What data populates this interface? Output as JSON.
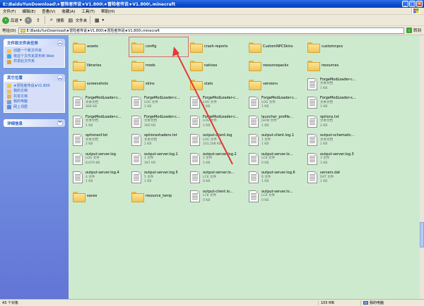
{
  "window": {
    "title": "E:\\BaiduYunDownload\\★冒险者传说★V1.800\\★冒险者传说★V1.800\\.minecraft",
    "btn_min": "_",
    "btn_max": "□",
    "btn_close": "×"
  },
  "menu": [
    "文件(F)",
    "编辑(E)",
    "查看(V)",
    "收藏(A)",
    "工具(T)",
    "帮助(H)"
  ],
  "toolbar": {
    "back_label": "后退",
    "search_label": "搜索",
    "folders_label": "文件夹"
  },
  "address": {
    "label": "地址(D)",
    "path": "E:\\BaiduYunDownload\\★冒险者传说★V1.800\\★冒险者传说★V1.800\\.minecraft",
    "go_label": "转到"
  },
  "sidebar": {
    "tasks_title": "文件和文件夹任务",
    "tasks": [
      "创建一个新文件夹",
      "将这个文件夹发布到 Web",
      "共享此文件夹"
    ],
    "places_title": "其它位置",
    "places": [
      "★冒险者传说★V1.800",
      "我的文档",
      "共享文档",
      "我的电脑",
      "网上邻居"
    ],
    "details_title": "详细信息"
  },
  "items": [
    {
      "name": "assets",
      "type": "folder"
    },
    {
      "name": "config",
      "type": "folder"
    },
    {
      "name": "crash-reports",
      "type": "folder"
    },
    {
      "name": "CustomNPCSkins",
      "type": "folder"
    },
    {
      "name": "customnpcs",
      "type": "folder"
    },
    {
      "name": "libraries",
      "type": "folder"
    },
    {
      "name": "mods",
      "type": "folder"
    },
    {
      "name": "natives",
      "type": "folder"
    },
    {
      "name": "resourcepacks",
      "type": "folder"
    },
    {
      "name": "resources",
      "type": "folder"
    },
    {
      "name": "screenshots",
      "type": "folder"
    },
    {
      "name": "skins",
      "type": "folder"
    },
    {
      "name": "stats",
      "type": "folder"
    },
    {
      "name": "versions",
      "type": "folder"
    },
    {
      "name": "ForgeModLoader-c...",
      "type": "file",
      "kind": "文本文档",
      "size": "1 KB"
    },
    {
      "name": "ForgeModLoader-c...",
      "type": "file",
      "kind": "文本文档",
      "size": "368 KB"
    },
    {
      "name": "ForgeModLoader-c...",
      "type": "file",
      "kind": "LOG 文件",
      "size": "1 KB"
    },
    {
      "name": "ForgeModLoader-c...",
      "type": "file",
      "kind": "LOG 文件",
      "size": "1 KB"
    },
    {
      "name": "ForgeModLoader-c...",
      "type": "file",
      "kind": "LOG 文件",
      "size": "1 KB"
    },
    {
      "name": "ForgeModLoader-s...",
      "type": "file",
      "kind": "文本文档",
      "size": "1 KB"
    },
    {
      "name": "ForgeModLoader-c...",
      "type": "file",
      "kind": "文本文档",
      "size": "1 KB"
    },
    {
      "name": "ForgeModLoader-c...",
      "type": "file",
      "kind": "文本文档",
      "size": "360 KB"
    },
    {
      "name": "ForgeModLoader-c...",
      "type": "file",
      "kind": "LOG 文件",
      "size": "1 KB"
    },
    {
      "name": "launcher_profile...",
      "type": "file",
      "kind": "JSON 文件",
      "size": "1 KB"
    },
    {
      "name": "options.txt",
      "type": "file",
      "kind": "文本文档",
      "size": "2 KB"
    },
    {
      "name": "optionsof.txt",
      "type": "file",
      "kind": "文本文档",
      "size": "2 KB"
    },
    {
      "name": "optionsshaders.txt",
      "type": "file",
      "kind": "文本文档",
      "size": "1 KB"
    },
    {
      "name": "output-client.log",
      "type": "file",
      "kind": "LOG 文件",
      "size": "101,508 KB"
    },
    {
      "name": "output-client.log.1",
      "type": "file",
      "kind": "1 文件",
      "size": "1 KB"
    },
    {
      "name": "output-schematic...",
      "type": "file",
      "kind": "文本文档",
      "size": "1 KB"
    },
    {
      "name": "output-server.log",
      "type": "file",
      "kind": "LOG 文件",
      "size": "6,079 KB"
    },
    {
      "name": "output-server.log.1",
      "type": "file",
      "kind": "1 文件",
      "size": "397 KB"
    },
    {
      "name": "output-server.log.2",
      "type": "file",
      "kind": "2 文件",
      "size": "2 KB"
    },
    {
      "name": "output-server.lo...",
      "type": "file",
      "kind": "LCK 文件",
      "size": "0 KB"
    },
    {
      "name": "output-server.log.3",
      "type": "file",
      "kind": "3 文件",
      "size": "1 KB"
    },
    {
      "name": "output-server.log.4",
      "type": "file",
      "kind": "4 文件",
      "size": "1 KB"
    },
    {
      "name": "output-server.log.5",
      "type": "file",
      "kind": "5 文件",
      "size": "1 KB"
    },
    {
      "name": "output-server.lo...",
      "type": "file",
      "kind": "LCK 文件",
      "size": "0 KB"
    },
    {
      "name": "output-server.log.6",
      "type": "file",
      "kind": "6 文件",
      "size": "1 KB"
    },
    {
      "name": "servers.dat",
      "type": "file",
      "kind": "DAT 文件",
      "size": "1 KB"
    },
    {
      "name": "saves",
      "type": "folder"
    },
    {
      "name": "resource_temp",
      "type": "folder"
    },
    {
      "name": "output-client.lo...",
      "type": "file",
      "kind": "LCK 文件",
      "size": "0 KB"
    },
    {
      "name": "output-server.lo...",
      "type": "file",
      "kind": "LCK 文件",
      "size": "0 KB"
    }
  ],
  "status": {
    "count": "43 个对象",
    "size": "105 MB",
    "location": "我的电脑"
  },
  "colors": {
    "sidebar_top": "#7ba2e7",
    "content_bg": "#cdeacf",
    "arrow": "#e53935"
  }
}
